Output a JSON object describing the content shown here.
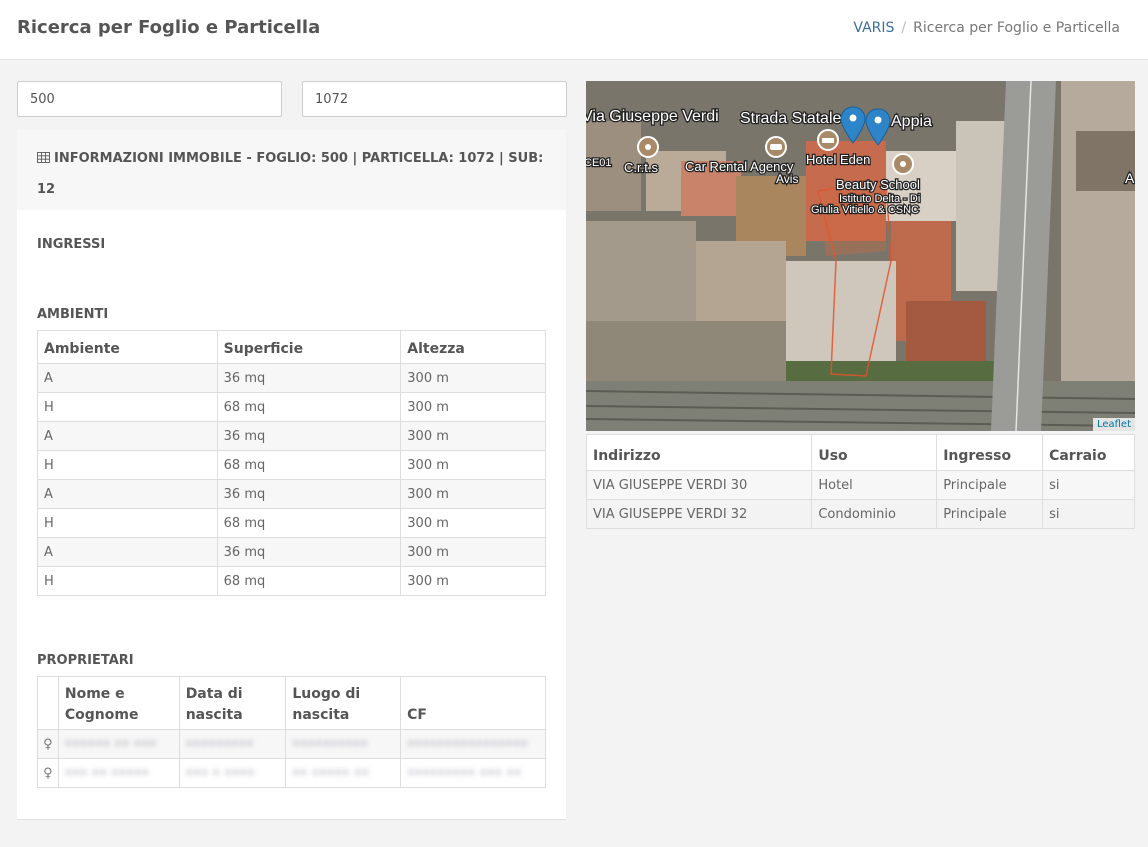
{
  "header": {
    "title": "Ricerca per Foglio e Particella",
    "breadcrumb": {
      "root": "VARIS",
      "separator": "/",
      "current": "Ricerca per Foglio e Particella"
    }
  },
  "search": {
    "foglio_value": "500",
    "particella_value": "1072"
  },
  "info_panel": {
    "heading": "INFORMAZIONI IMMOBILE - FOGLIO: 500 | PARTICELLA: 1072 | SUB: 12",
    "heading_icon": "table-icon",
    "ingressi_title": "INGRESSI",
    "ambienti_title": "AMBIENTI",
    "ambienti_columns": [
      "Ambiente",
      "Superficie",
      "Altezza"
    ],
    "ambienti_rows": [
      [
        "A",
        "36 mq",
        "300 m"
      ],
      [
        "H",
        "68 mq",
        "300 m"
      ],
      [
        "A",
        "36 mq",
        "300 m"
      ],
      [
        "H",
        "68 mq",
        "300 m"
      ],
      [
        "A",
        "36 mq",
        "300 m"
      ],
      [
        "H",
        "68 mq",
        "300 m"
      ],
      [
        "A",
        "36 mq",
        "300 m"
      ],
      [
        "H",
        "68 mq",
        "300 m"
      ]
    ],
    "proprietari_title": "PROPRIETARI",
    "proprietari_columns": [
      "Nome e Cognome",
      "Data di nascita",
      "Luogo di nascita",
      "CF"
    ],
    "proprietari_rows": [
      {
        "sex_icon": "female-icon",
        "sex_glyph": "♀",
        "name": "•••••• •• •••",
        "birth_date": "•••••••••",
        "birth_place": "••••••••••",
        "cf": "••••••••••••••••"
      },
      {
        "sex_icon": "female-icon",
        "sex_glyph": "♀",
        "name": "••• •• •••••",
        "birth_date": "••• • ••••",
        "birth_place": "•• ••••• ••",
        "cf": "••••••••• ••• ••"
      }
    ]
  },
  "map": {
    "labels": {
      "street_1": "Via Giuseppe Verdi",
      "street_2": "Strada Statale",
      "street_2_suffix": "Appia",
      "crts": "C.r.t.s",
      "car_rental": "Car Rental Agency",
      "car_rental_brand": "Avis",
      "hotel": "Hotel Eden",
      "beauty_school": "Beauty School",
      "beauty_sub_1": "Istituto Delta - Di",
      "beauty_sub_2": "Giulia Vitiello & CSNC",
      "edge_left": "CE01",
      "edge_right": "A"
    },
    "attribution": "Leaflet"
  },
  "addresses": {
    "columns": [
      "Indirizzo",
      "Uso",
      "Ingresso",
      "Carraio"
    ],
    "rows": [
      [
        "VIA GIUSEPPE VERDI 30",
        "Hotel",
        "Principale",
        "si"
      ],
      [
        "VIA GIUSEPPE VERDI 32",
        "Condominio",
        "Principale",
        "si"
      ]
    ]
  }
}
